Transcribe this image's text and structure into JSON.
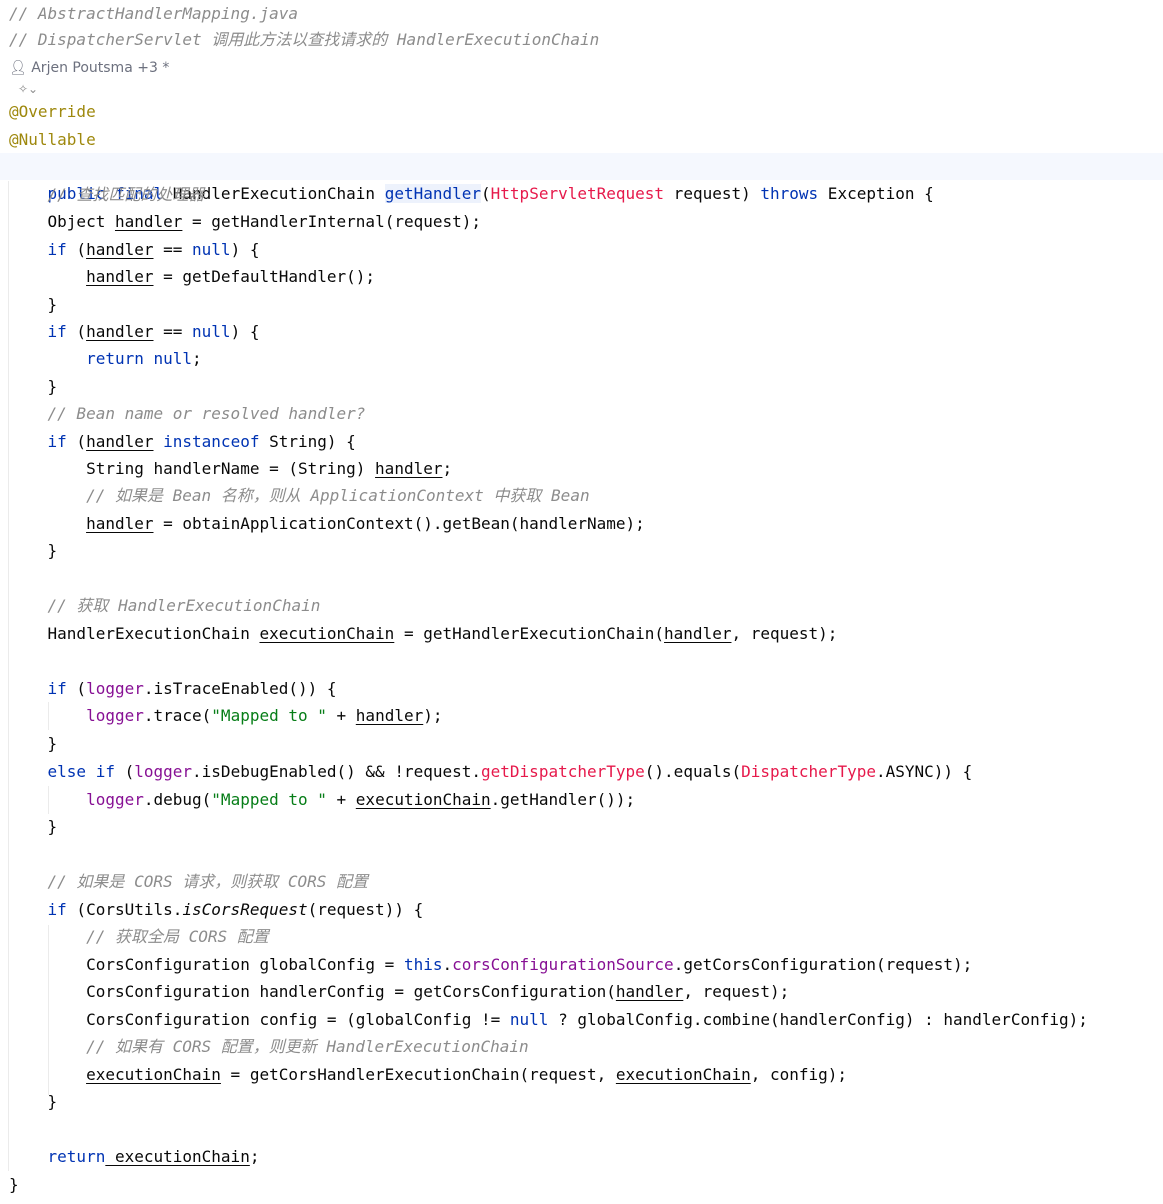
{
  "header": {
    "comment1": "// AbstractHandlerMapping.java",
    "comment2": "// DispatcherServlet 调用此方法以查找请求的 HandlerExecutionChain"
  },
  "meta": {
    "authors": "Arjen Poutsma +3 *",
    "user_icon": "user-icon",
    "inlay_icon": "ai-inlay-icon"
  },
  "code": {
    "l1": "@Override",
    "l2": "@Nullable",
    "l3a": "public final ",
    "l3b": "HandlerExecutionChain ",
    "l3c": "getHandler",
    "l3d": "(",
    "l3e": "HttpServletRequest",
    "l3f": " request) ",
    "l3g": "throws",
    "l3h": " Exception {",
    "l4": "    // 查找匹配的处理器",
    "l5a": "    Object ",
    "l5b": "handler",
    "l5c": " = getHandlerInternal(request);",
    "l6a": "    if",
    "l6b": " (",
    "l6c": "handler",
    "l6d": " == ",
    "l6e": "null",
    "l6f": ") {",
    "l7a": "        ",
    "l7b": "handler",
    "l7c": " = getDefaultHandler();",
    "l8": "    }",
    "l9a": "    if",
    "l9b": " (",
    "l9c": "handler",
    "l9d": " == ",
    "l9e": "null",
    "l9f": ") {",
    "l10a": "        return",
    "l10b": " null",
    "l10c": ";",
    "l11": "    }",
    "l12": "    // Bean name or resolved handler?",
    "l13a": "    if",
    "l13b": " (",
    "l13c": "handler",
    "l13d": " instanceof",
    "l13e": " String) {",
    "l14a": "        String handlerName = (String) ",
    "l14b": "handler",
    "l14c": ";",
    "l15": "        // 如果是 Bean 名称，则从 ApplicationContext 中获取 Bean",
    "l16a": "        ",
    "l16b": "handler",
    "l16c": " = obtainApplicationContext().getBean(handlerName);",
    "l17": "    }",
    "l18": "    // 获取 HandlerExecutionChain",
    "l19a": "    HandlerExecutionChain ",
    "l19b": "executionChain",
    "l19c": " = getHandlerExecutionChain(",
    "l19d": "handler",
    "l19e": ", request);",
    "l20a": "    if",
    "l20b": " (",
    "l20c": "logger",
    "l20d": ".isTraceEnabled()) {",
    "l21a": "        ",
    "l21b": "logger",
    "l21c": ".trace(",
    "l21d": "\"Mapped to \"",
    "l21e": " + ",
    "l21f": "handler",
    "l21g": ");",
    "l22": "    }",
    "l23a": "    else if",
    "l23b": " (",
    "l23c": "logger",
    "l23d": ".isDebugEnabled() && !request.",
    "l23e": "getDispatcherType",
    "l23f": "().equals(",
    "l23g": "DispatcherType",
    "l23h": ".ASYNC)) {",
    "l24a": "        ",
    "l24b": "logger",
    "l24c": ".debug(",
    "l24d": "\"Mapped to \"",
    "l24e": " + ",
    "l24f": "executionChain",
    "l24g": ".getHandler());",
    "l25": "    }",
    "l26": "    // 如果是 CORS 请求，则获取 CORS 配置",
    "l27a": "    if",
    "l27b": " (CorsUtils.",
    "l27c": "isCorsRequest",
    "l27d": "(request)) {",
    "l28": "        // 获取全局 CORS 配置",
    "l29a": "        CorsConfiguration globalConfig = ",
    "l29b": "this",
    "l29c": ".",
    "l29d": "corsConfigurationSource",
    "l29e": ".getCorsConfiguration(request);",
    "l30a": "        CorsConfiguration handlerConfig = getCorsConfiguration(",
    "l30b": "handler",
    "l30c": ", request);",
    "l31a": "        CorsConfiguration config = (globalConfig != ",
    "l31b": "null",
    "l31c": " ? globalConfig.combine(handlerConfig) : handlerConfig);",
    "l32": "        // 如果有 CORS 配置，则更新 HandlerExecutionChain",
    "l33a": "        ",
    "l33b": "executionChain",
    "l33c": " = getCorsHandlerExecutionChain(request, ",
    "l33d": "executionChain",
    "l33e": ", config);",
    "l34": "    }",
    "l35a": "    return",
    "l35b": " executionChain",
    "l35c": ";",
    "l36": "}"
  },
  "colors": {
    "keyword": "#0033b3",
    "comment": "#8c8c8c",
    "annotation": "#9e880d",
    "string": "#067d17",
    "field": "#871094",
    "highlight": "#e6194b"
  }
}
